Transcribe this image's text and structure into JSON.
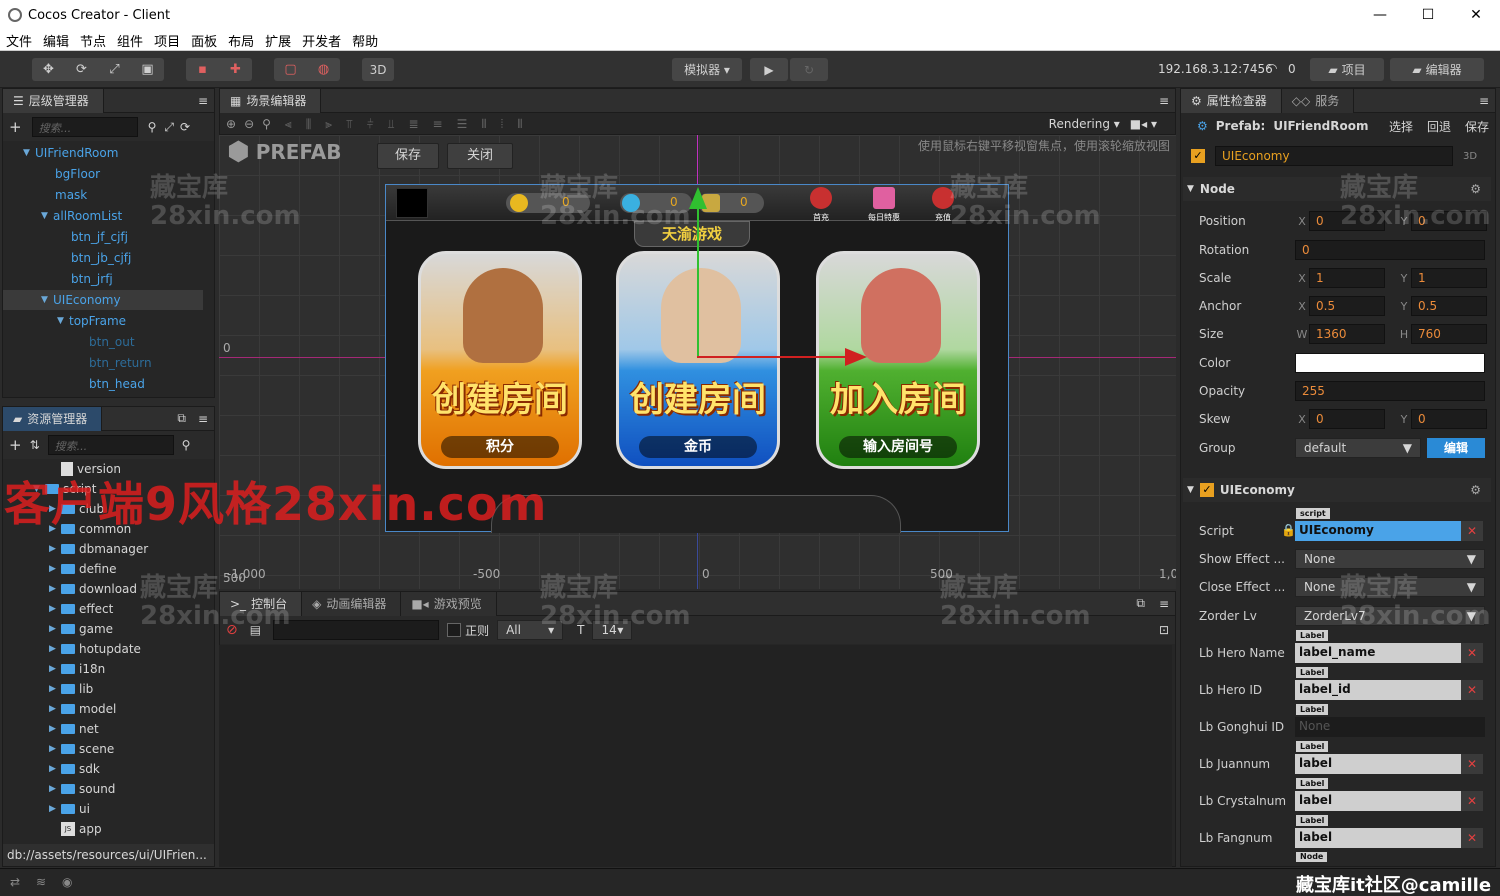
{
  "window": {
    "title": "Cocos Creator - Client",
    "minimize": "—",
    "maximize": "☐",
    "close": "✕"
  },
  "menu": [
    "文件",
    "编辑",
    "节点",
    "组件",
    "项目",
    "面板",
    "布局",
    "扩展",
    "开发者",
    "帮助"
  ],
  "toolbar": {
    "btn_3d": "3D",
    "simulator": "模拟器 ▾",
    "play": "▶",
    "refresh": "↻",
    "ip": "192.168.3.12:7456",
    "wifi_count": "0",
    "project_btn": "项目",
    "editor_btn": "编辑器"
  },
  "hierarchy": {
    "title": "层级管理器",
    "search_placeholder": "搜索...",
    "items": [
      {
        "label": "UIFriendRoom",
        "depth": 0,
        "arrow": "▼"
      },
      {
        "label": "bgFloor",
        "depth": 1,
        "arrow": ""
      },
      {
        "label": "mask",
        "depth": 1,
        "arrow": ""
      },
      {
        "label": "allRoomList",
        "depth": 1,
        "arrow": "▼"
      },
      {
        "label": "btn_jf_cjfj",
        "depth": 2,
        "arrow": ""
      },
      {
        "label": "btn_jb_cjfj",
        "depth": 2,
        "arrow": ""
      },
      {
        "label": "btn_jrfj",
        "depth": 2,
        "arrow": ""
      },
      {
        "label": "UIEconomy",
        "depth": 1,
        "arrow": "▼"
      },
      {
        "label": "topFrame",
        "depth": 2,
        "arrow": "▼"
      },
      {
        "label": "btn_out",
        "depth": 3,
        "arrow": ""
      },
      {
        "label": "btn_return",
        "depth": 3,
        "arrow": ""
      },
      {
        "label": "btn_head",
        "depth": 3,
        "arrow": ""
      }
    ]
  },
  "assets": {
    "title": "资源管理器",
    "search_placeholder": "搜索...",
    "items": [
      "version",
      "script",
      "club",
      "common",
      "dbmanager",
      "define",
      "download",
      "effect",
      "game",
      "hotupdate",
      "i18n",
      "lib",
      "model",
      "net",
      "scene",
      "sdk",
      "sound",
      "ui",
      "app"
    ],
    "path": "db://assets/resources/ui/UIFrien..."
  },
  "scene_editor": {
    "title": "场景编辑器",
    "rendering": "Rendering",
    "prefab_label": "PREFAB",
    "save": "保存",
    "close": "关闭",
    "hint": "使用鼠标右键平移视窗焦点，使用滚轮缩放视图",
    "axis_labels": [
      "-1,000",
      "-500",
      "0",
      "500",
      "1,0",
      "0",
      "500"
    ],
    "game": {
      "counters": [
        "0",
        "0",
        "0"
      ],
      "top_icons": [
        "首充",
        "每日特惠",
        "充值"
      ],
      "banner": "天渝游戏",
      "cards": [
        {
          "title": "创建房间",
          "sub": "积分"
        },
        {
          "title": "创建房间",
          "sub": "金币"
        },
        {
          "title": "加入房间",
          "sub": "输入房间号"
        }
      ]
    }
  },
  "console": {
    "tabs": [
      "控制台",
      "动画编辑器",
      "游戏预览"
    ],
    "regex": "正则",
    "filter": "All",
    "font_size": "14"
  },
  "inspector": {
    "title": "属性检查器",
    "service_tab": "服务",
    "prefab_label": "Prefab:",
    "prefab_name": "UIFriendRoom",
    "select": "选择",
    "revert": "回退",
    "save": "保存",
    "node_name": "UIEconomy",
    "btn_3d": "3D",
    "node_section": "Node",
    "position": {
      "label": "Position",
      "x": "0",
      "y": "0"
    },
    "rotation": {
      "label": "Rotation",
      "value": "0"
    },
    "scale": {
      "label": "Scale",
      "x": "1",
      "y": "1"
    },
    "anchor": {
      "label": "Anchor",
      "x": "0.5",
      "y": "0.5"
    },
    "size": {
      "label": "Size",
      "w": "1360",
      "h": "760"
    },
    "color": {
      "label": "Color",
      "value": "#ffffff"
    },
    "opacity": {
      "label": "Opacity",
      "value": "255"
    },
    "skew": {
      "label": "Skew",
      "x": "0",
      "y": "0"
    },
    "group": {
      "label": "Group",
      "value": "default",
      "edit": "编辑"
    },
    "component": "UIEconomy",
    "script": {
      "label": "Script",
      "tag": "script",
      "value": "UIEconomy"
    },
    "show_effect": {
      "label": "Show Effect ...",
      "value": "None"
    },
    "close_effect": {
      "label": "Close Effect ...",
      "value": "None"
    },
    "zorder": {
      "label": "Zorder Lv",
      "value": "ZorderLv7"
    },
    "refs": [
      {
        "label": "Lb Hero Name",
        "tag": "Label",
        "value": "label_name"
      },
      {
        "label": "Lb Hero ID",
        "tag": "Label",
        "value": "label_id"
      },
      {
        "label": "Lb Gonghui ID",
        "tag": "Label",
        "value": "None"
      },
      {
        "label": "Lb Juannum",
        "tag": "Label",
        "value": "label"
      },
      {
        "label": "Lb Crystalnum",
        "tag": "Label",
        "value": "label"
      },
      {
        "label": "Lb Fangnum",
        "tag": "Label",
        "value": "label"
      }
    ],
    "next_tag": "Node"
  },
  "watermarks": {
    "cn": "藏宝库",
    "en": "28xin.com",
    "red": "客户端9风格28xin.com",
    "footer": "藏宝库it社区@camille"
  },
  "colors": {
    "accent": "#4aa3e8",
    "field_value": "#eb8b3a",
    "edit_button": "#2a8ad6"
  }
}
